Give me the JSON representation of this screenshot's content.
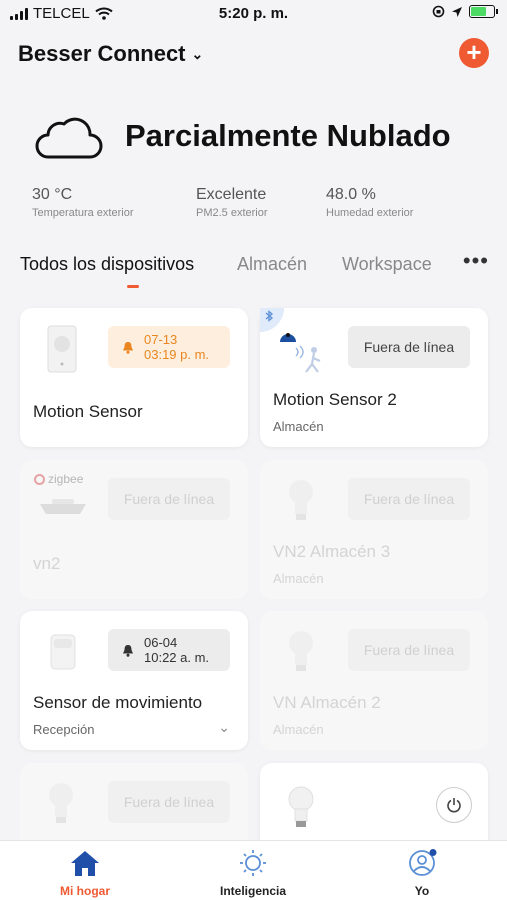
{
  "status_bar": {
    "carrier": "TELCEL",
    "time": "5:20 p. m."
  },
  "header": {
    "title": "Besser Connect"
  },
  "weather": {
    "condition": "Parcialmente Nublado",
    "stats": [
      {
        "value": "30 °C",
        "label": "Temperatura exterior"
      },
      {
        "value": "Excelente",
        "label": "PM2.5 exterior"
      },
      {
        "value": "48.0 %",
        "label": "Humedad exterior"
      }
    ]
  },
  "tabs": [
    {
      "label": "Todos los dispositivos"
    },
    {
      "label": "Almacén"
    },
    {
      "label": "Workspace"
    }
  ],
  "devices": [
    {
      "name": "Motion Sensor",
      "badge_date": "07-13",
      "badge_time": "03:19 p. m."
    },
    {
      "name": "Motion Sensor 2",
      "room": "Almacén",
      "status": "Fuera de línea"
    },
    {
      "name": "vn2",
      "status": "Fuera de línea",
      "brand": "zigbee"
    },
    {
      "name": "VN2 Almacén 3",
      "room": "Almacén",
      "status": "Fuera de línea"
    },
    {
      "name": "Sensor de movimiento",
      "room": "Recepción",
      "badge_date": "06-04",
      "badge_time": "10:22 a. m."
    },
    {
      "name": "VN Almacén 2",
      "room": "Almacén",
      "status": "Fuera de línea"
    },
    {
      "status": "Fuera de línea"
    },
    {}
  ],
  "nav": [
    {
      "label": "Mi hogar"
    },
    {
      "label": "Inteligencia"
    },
    {
      "label": "Yo"
    }
  ],
  "colors": {
    "accent": "#ef5a33",
    "nav_active": "#1f4fa8",
    "badge_orange": "#e9861f"
  }
}
